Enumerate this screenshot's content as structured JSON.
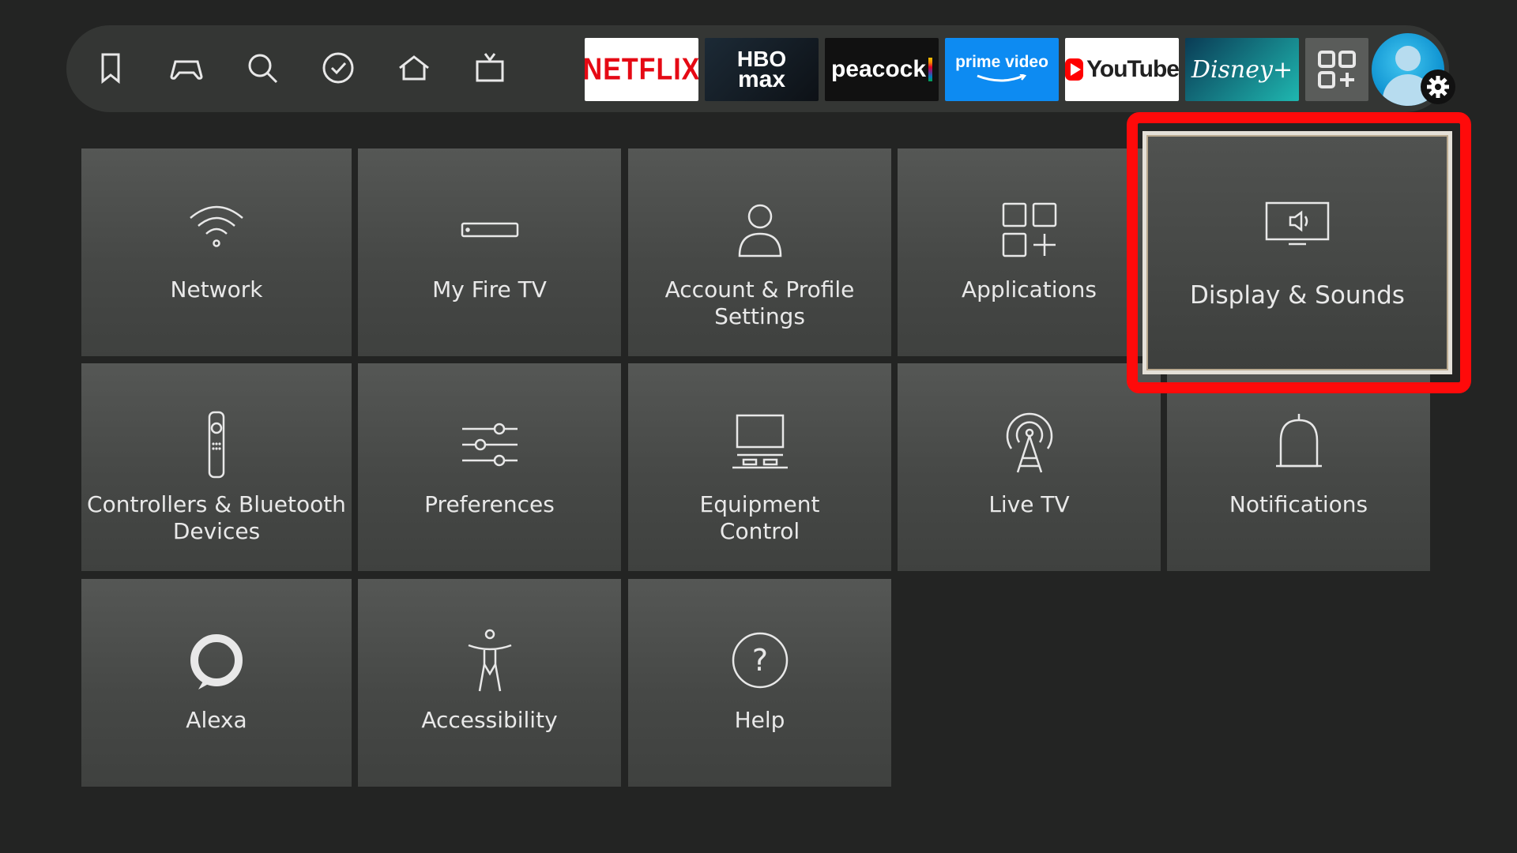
{
  "nav": {
    "icons": [
      "bookmark-icon",
      "gamepad-icon",
      "search-icon",
      "check-circle-icon",
      "home-icon",
      "live-tv-icon"
    ],
    "apps": {
      "netflix": "NETFLIX",
      "hbo_line1": "HBO",
      "hbo_line2": "max",
      "peacock": "peacock",
      "prime_line1": "prime video",
      "youtube": "YouTube",
      "disney": "Disney+"
    }
  },
  "settings": {
    "network": "Network",
    "my_fire_tv": "My Fire TV",
    "account": "Account & Profile\nSettings",
    "applications": "Applications",
    "display_sounds": "Display & Sounds",
    "controllers": "Controllers & Bluetooth\nDevices",
    "preferences": "Preferences",
    "equipment": "Equipment\nControl",
    "live_tv": "Live TV",
    "notifications": "Notifications",
    "alexa": "Alexa",
    "accessibility": "Accessibility",
    "help": "Help"
  },
  "colors": {
    "highlight": "#ff0a0a",
    "focus_border": "#e4e0d8"
  }
}
